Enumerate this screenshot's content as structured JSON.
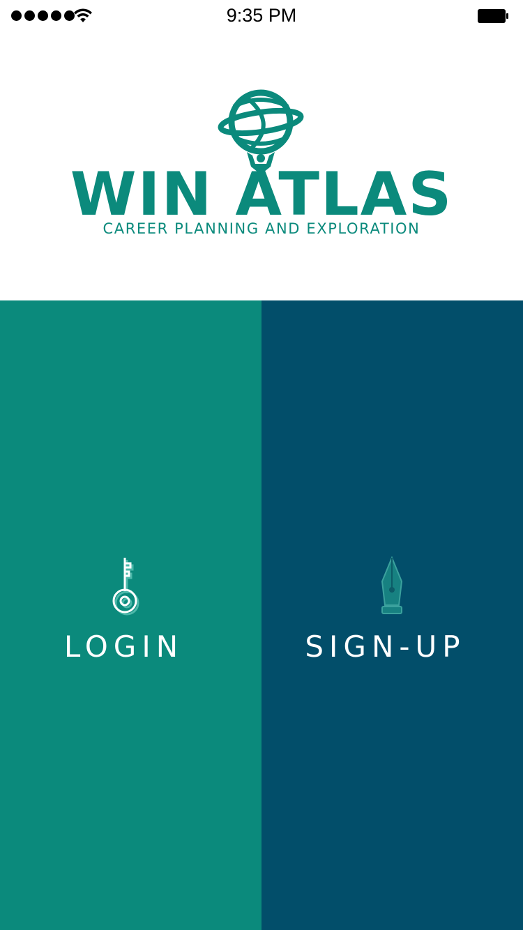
{
  "status_bar": {
    "time": "9:35 PM",
    "signal_icon": "signal-dots-icon",
    "wifi_icon": "wifi-icon",
    "battery_icon": "battery-icon"
  },
  "logo": {
    "wordmark": "WIN ATLAS",
    "tagline": "CAREER PLANNING AND EXPLORATION",
    "icon": "globe-figure-icon"
  },
  "actions": {
    "login": {
      "label": "LOGIN",
      "icon": "key-icon"
    },
    "signup": {
      "label": "SIGN-UP",
      "icon": "fountain-pen-icon"
    }
  },
  "colors": {
    "teal": "#0b8a7c",
    "navy": "#024e6a",
    "white": "#ffffff"
  }
}
